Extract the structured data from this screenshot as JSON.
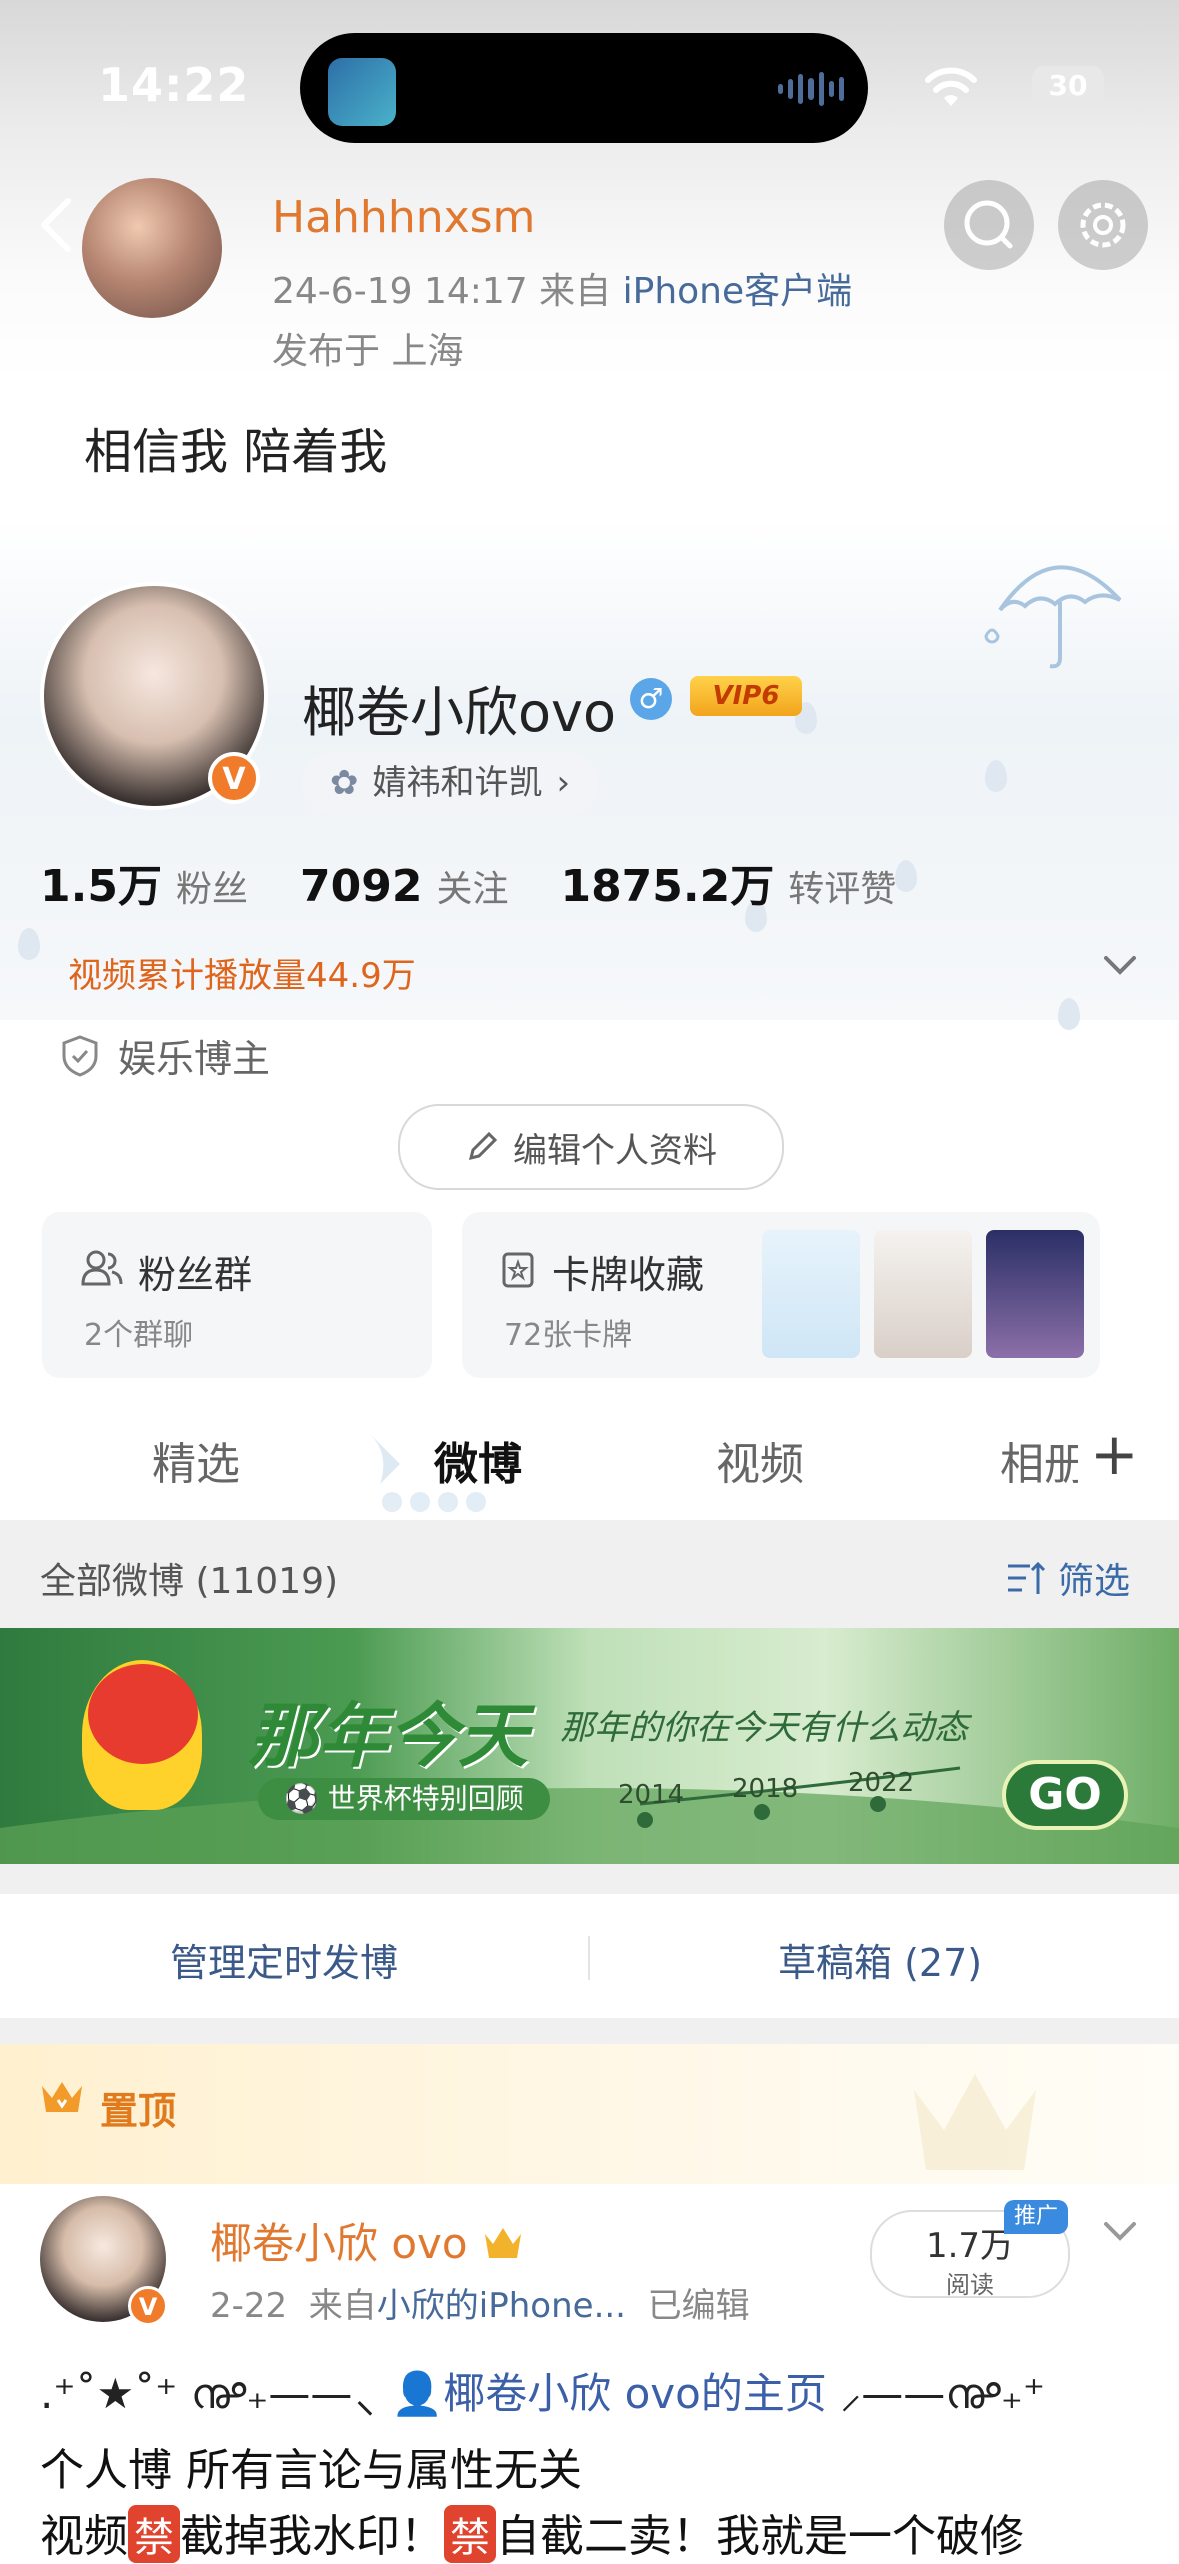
{
  "status_bar": {
    "time": "14:22",
    "battery": "30"
  },
  "post_header": {
    "username": "Hahhhnxsm",
    "date_time": "24-6-19 14:17",
    "source_prefix": "来自",
    "device": "iPhone客户端",
    "location": "发布于 上海"
  },
  "post_text": "相信我 陪着我",
  "profile": {
    "name": "椰卷小欣ovo",
    "gender_symbol": "♂",
    "vip": "VIP6",
    "verified_badge": "V",
    "tag": "婧祎和许凯",
    "tag_chevron": "›",
    "stats": [
      {
        "value": "1.5万",
        "label": "粉丝"
      },
      {
        "value": "7092",
        "label": "关注"
      },
      {
        "value": "1875.2万",
        "label": "转评赞"
      }
    ],
    "video_views": "视频累计播放量44.9万",
    "category": "娱乐博主",
    "edit_button": "编辑个人资料"
  },
  "cards": {
    "fans": {
      "title": "粉丝群",
      "subtitle": "2个群聊"
    },
    "cards": {
      "title": "卡牌收藏",
      "subtitle": "72张卡牌"
    }
  },
  "tabs": [
    {
      "label": "精选"
    },
    {
      "label": "微博"
    },
    {
      "label": "视频"
    },
    {
      "label": "相册"
    }
  ],
  "tab_plus": "+",
  "feed_header": {
    "all": "全部微博 (11019)",
    "filter": "筛选"
  },
  "banner": {
    "title": "那年今天",
    "subtitle": "那年的你在今天有什么动态",
    "pill": "⚽ 世界杯特别回顾",
    "years": [
      "2014",
      "2018",
      "2022"
    ],
    "go": "GO"
  },
  "actions": {
    "scheduled": "管理定时发博",
    "drafts": "草稿箱 (27)"
  },
  "pinned_label": "置顶",
  "pinned_post": {
    "name": "椰卷小欣 ovo",
    "date": "2-22",
    "source_prefix": "来自",
    "device": "小欣的iPhone...",
    "edited": "已编辑",
    "reads_value": "1.7万",
    "reads_label": "阅读",
    "promo": "推广",
    "line1_left": ".⁺˚★˚⁺ ൲₊——⸜",
    "line1_link": "椰卷小欣 ovo的主页",
    "line1_right": "⸝——൲₊⁺",
    "line2": "个人博 所有言论与属性无关",
    "line3_a": "视频",
    "ban": "禁",
    "line3_b": "截掉我水印！",
    "line3_c": "自截二卖！我就是一个破修"
  },
  "colors": {
    "accent_orange": "#e07830",
    "link_blue": "#466a9a",
    "banner_green": "#2e8a36"
  }
}
